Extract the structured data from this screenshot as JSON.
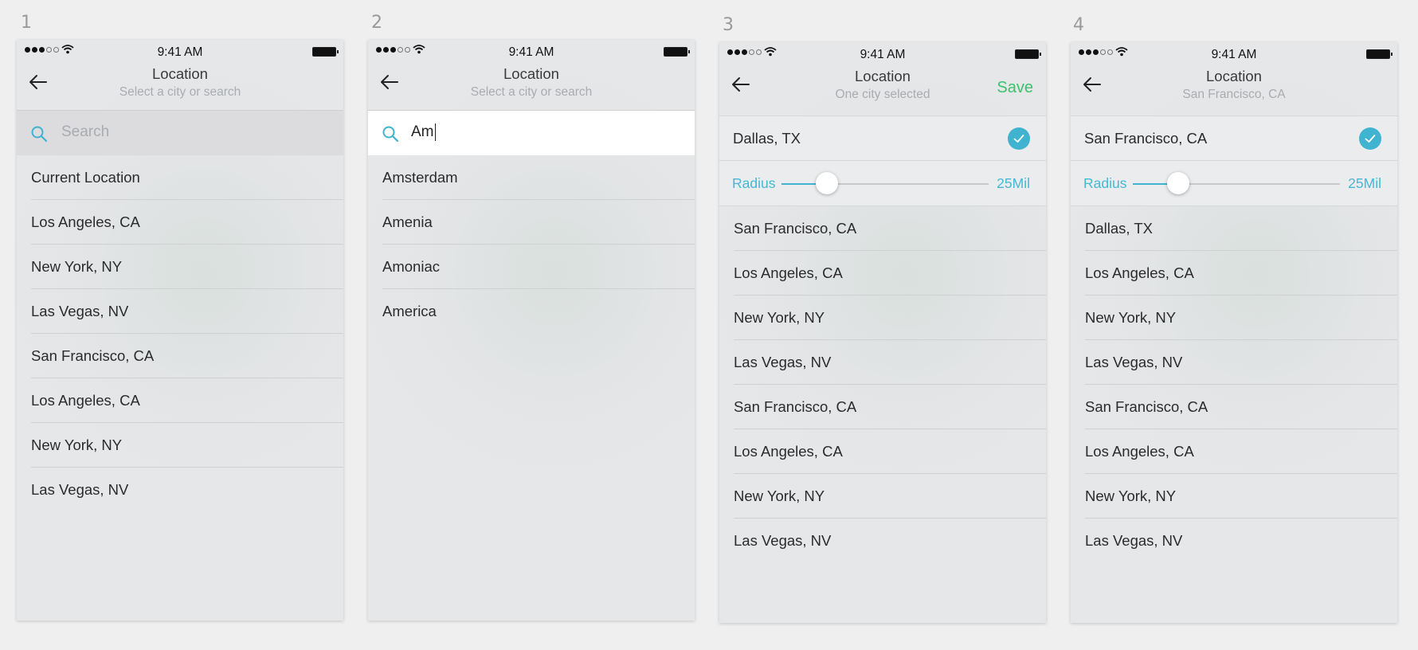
{
  "screens": [
    {
      "step": "1",
      "status": {
        "time": "9:41 AM"
      },
      "nav": {
        "title": "Location",
        "subtitle": "Select a city or search"
      },
      "search": {
        "placeholder": "Search",
        "value": ""
      },
      "items": [
        "Current Location",
        "Los Angeles, CA",
        "New York, NY",
        "Las Vegas, NV",
        "San Francisco, CA",
        "Los Angeles, CA",
        "New York, NY",
        "Las Vegas, NV"
      ]
    },
    {
      "step": "2",
      "status": {
        "time": "9:41 AM"
      },
      "nav": {
        "title": "Location",
        "subtitle": "Select a city or search"
      },
      "search": {
        "value": "Am"
      },
      "items": [
        "Amsterdam",
        "Amenia",
        "Amoniac",
        "America"
      ]
    },
    {
      "step": "3",
      "status": {
        "time": "9:41 AM"
      },
      "nav": {
        "title": "Location",
        "subtitle": "One city selected",
        "action": "Save"
      },
      "selected": {
        "city": "Dallas, TX"
      },
      "radius": {
        "label": "Radius",
        "value": "25Mil",
        "fraction": 0.22
      },
      "items": [
        "San Francisco, CA",
        "Los Angeles, CA",
        "New York, NY",
        "Las Vegas, NV",
        "San Francisco, CA",
        "Los Angeles, CA",
        "New York, NY",
        "Las Vegas, NV"
      ]
    },
    {
      "step": "4",
      "status": {
        "time": "9:41 AM"
      },
      "nav": {
        "title": "Location",
        "subtitle": "San Francisco, CA"
      },
      "selected": {
        "city": "San Francisco, CA"
      },
      "radius": {
        "label": "Radius",
        "value": "25Mil",
        "fraction": 0.22
      },
      "items": [
        "Dallas, TX",
        "Los Angeles, CA",
        "New York, NY",
        "Las Vegas, NV",
        "San Francisco, CA",
        "Los Angeles, CA",
        "New York, NY",
        "Las Vegas, NV"
      ]
    }
  ],
  "colors": {
    "accent": "#3fb3cf",
    "save": "#3cc26b",
    "background": "#efefef"
  }
}
